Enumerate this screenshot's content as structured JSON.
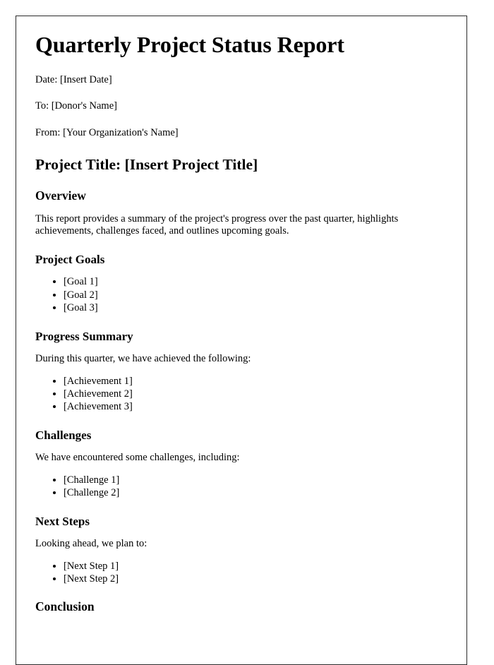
{
  "document": {
    "title": "Quarterly Project Status Report",
    "meta": [
      {
        "label": "Date:",
        "value": "[Insert Date]",
        "line": "Date: [Insert Date]"
      },
      {
        "label": "To:",
        "value": "[Donor's Name]",
        "line": "To: [Donor's Name]"
      },
      {
        "label": "From:",
        "value": "[Your Organization's Name]",
        "line": "From: [Your Organization's Name]"
      }
    ],
    "project_title_line": "Project Title: [Insert Project Title]",
    "sections": {
      "overview": {
        "heading": "Overview",
        "paragraph": "This report provides a summary of the project's progress over the past quarter, highlights achievements, challenges faced, and outlines upcoming goals."
      },
      "project_goals": {
        "heading": "Project Goals",
        "items": [
          "[Goal 1]",
          "[Goal 2]",
          "[Goal 3]"
        ]
      },
      "progress_summary": {
        "heading": "Progress Summary",
        "intro": "During this quarter, we have achieved the following:",
        "items": [
          "[Achievement 1]",
          "[Achievement 2]",
          "[Achievement 3]"
        ]
      },
      "challenges": {
        "heading": "Challenges",
        "intro": "We have encountered some challenges, including:",
        "items": [
          "[Challenge 1]",
          "[Challenge 2]"
        ]
      },
      "next_steps": {
        "heading": "Next Steps",
        "intro": "Looking ahead, we plan to:",
        "items": [
          "[Next Step 1]",
          "[Next Step 2]"
        ]
      },
      "conclusion": {
        "heading": "Conclusion"
      }
    }
  },
  "style": {
    "page_border_color": "#2b2b2b",
    "page_background": "#ffffff",
    "text_color": "#000000"
  }
}
